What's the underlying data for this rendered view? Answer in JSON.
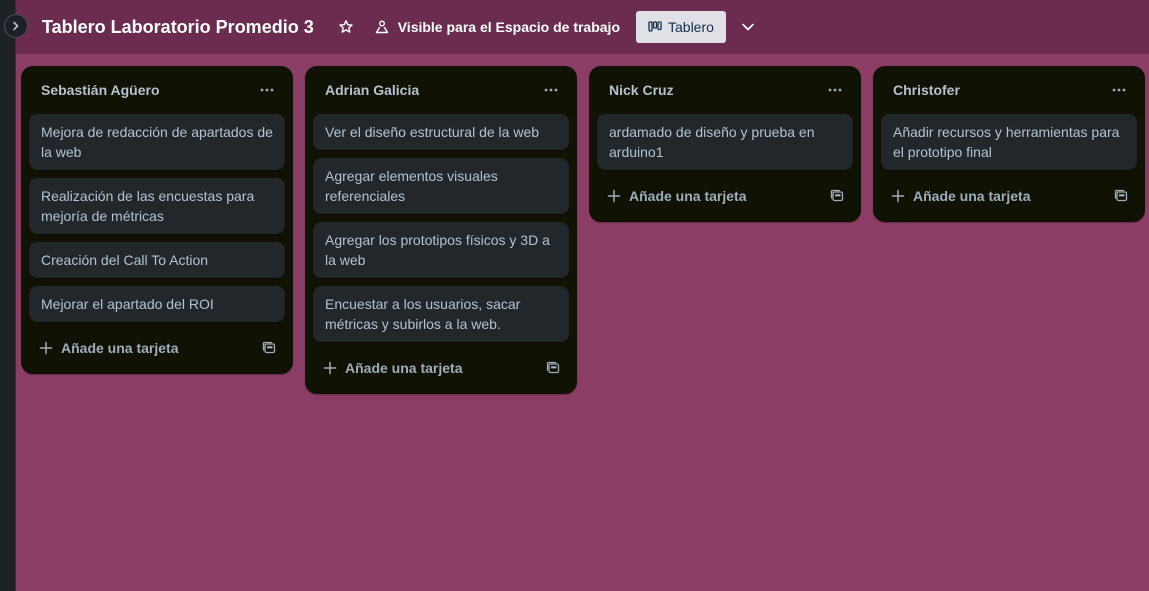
{
  "board": {
    "title": "Tablero Laboratorio Promedio 3",
    "visibility_label": "Visible para el Espacio de trabajo",
    "view_label": "Tablero"
  },
  "lists": [
    {
      "title": "Sebastián Agüero",
      "cards": [
        "Mejora de redacción de apartados de la web",
        "Realización de las encuestas para mejoría de métricas",
        "Creación del Call To Action",
        "Mejorar el apartado del ROI"
      ],
      "add_label": "Añade una tarjeta"
    },
    {
      "title": "Adrian Galicia",
      "cards": [
        "Ver el diseño estructural de la web",
        "Agregar elementos visuales referenciales",
        "Agregar los prototipos físicos y 3D a la web",
        "Encuestar a los usuarios, sacar métricas y subirlos a la web."
      ],
      "add_label": "Añade una tarjeta"
    },
    {
      "title": "Nick Cruz",
      "cards": [
        "ardamado de diseño y prueba en arduino1"
      ],
      "add_label": "Añade una tarjeta"
    },
    {
      "title": "Christofer",
      "cards": [
        "Añadir recursos y herramientas para el prototipo final"
      ],
      "add_label": "Añade una tarjeta"
    }
  ],
  "icons": {
    "sidebar_toggle": "chevron-right-icon",
    "star": "star-icon",
    "visibility": "workspace-visibility-icon",
    "view": "board-view-icon",
    "view_switcher": "chevron-down-icon",
    "list_menu": "more-dots-icon",
    "add": "plus-icon",
    "template": "card-template-icon"
  },
  "colors": {
    "background": "#8b3d66",
    "header": "#6b2c4f",
    "list": "#101204",
    "card": "#22272b",
    "text": "#b6c2cf"
  }
}
